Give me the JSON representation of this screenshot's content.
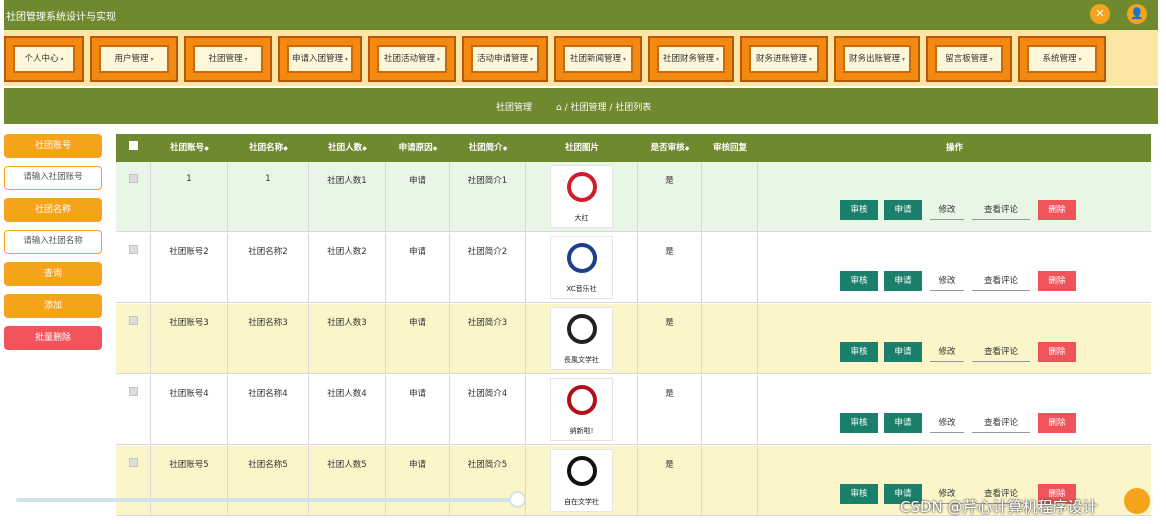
{
  "app": {
    "title": "社团管理系统设计与实现"
  },
  "nav": [
    "个人中心",
    "用户管理",
    "社团管理",
    "申请入团管理",
    "社团活动管理",
    "活动申请管理",
    "社团新闻管理",
    "社团财务管理",
    "财务进账管理",
    "财务出账管理",
    "留言板管理",
    "系统管理"
  ],
  "breadcrumb": {
    "title": "社团管理",
    "path": "/ 社团管理 / 社团列表"
  },
  "sidebar": {
    "label_id": "社团账号",
    "input_id_placeholder": "请输入社团账号",
    "label_name": "社团名称",
    "input_name_placeholder": "请输入社团名称",
    "search": "查询",
    "add": "添加",
    "batch_delete": "批量删除"
  },
  "table": {
    "headers": [
      "社团账号",
      "社团名称",
      "社团人数",
      "申请原因",
      "社团简介",
      "社团图片",
      "是否审核",
      "审核回复",
      "操作"
    ],
    "sort_mark": "◆",
    "actions": [
      "审核",
      "申请",
      "修改",
      "查看评论",
      "删除"
    ],
    "rows": [
      {
        "id": "1",
        "name": "1",
        "count": "社团人数1",
        "reason": "申请",
        "intro": "社团简介1",
        "approved": "是",
        "reply": "",
        "logo_text": "大红"
      },
      {
        "id": "社团账号2",
        "name": "社团名称2",
        "count": "社团人数2",
        "reason": "申请",
        "intro": "社团简介2",
        "approved": "是",
        "reply": "",
        "logo_text": "XC音乐社"
      },
      {
        "id": "社团账号3",
        "name": "社团名称3",
        "count": "社团人数3",
        "reason": "申请",
        "intro": "社团简介3",
        "approved": "是",
        "reply": "",
        "logo_text": "長風文学社"
      },
      {
        "id": "社团账号4",
        "name": "社团名称4",
        "count": "社团人数4",
        "reason": "申请",
        "intro": "社团简介4",
        "approved": "是",
        "reply": "",
        "logo_text": "纳新啦!"
      },
      {
        "id": "社团账号5",
        "name": "社团名称5",
        "count": "社团人数5",
        "reason": "申请",
        "intro": "社团简介5",
        "approved": "是",
        "reply": "",
        "logo_text": "自在文学社"
      }
    ],
    "row_colors": [
      "#e8f6e6",
      "#ffffff",
      "#fbf5c9",
      "#ffffff",
      "#fbf5c9"
    ]
  },
  "watermark": "CSDN @芹心计算机程序设计",
  "colors": {
    "header": "#6f8a2e",
    "accent": "#f5a31a",
    "teal": "#1a7f6b",
    "danger": "#f0535a"
  }
}
